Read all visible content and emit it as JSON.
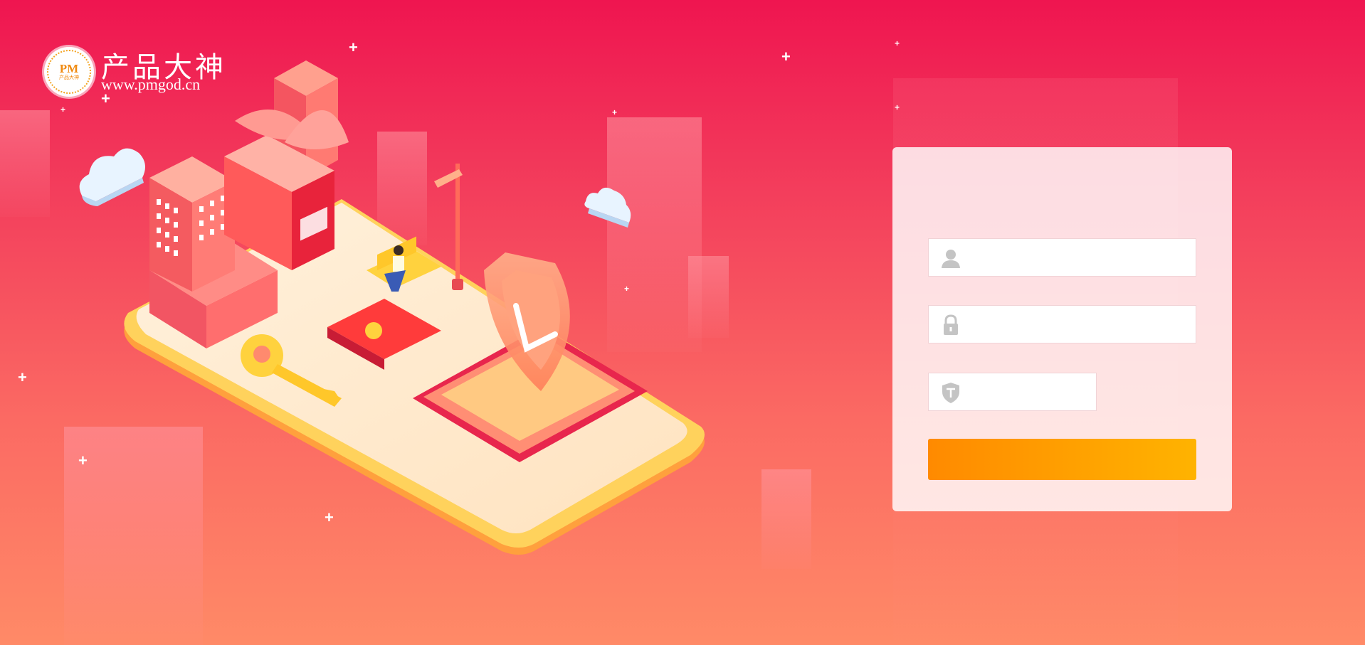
{
  "brand": {
    "name": "产品大神",
    "url": "www.pmgod.cn",
    "seal_text": "PM",
    "seal_subtext": "产品大神"
  },
  "login": {
    "username": {
      "value": "",
      "placeholder": ""
    },
    "password": {
      "value": "",
      "placeholder": ""
    },
    "captcha": {
      "value": "",
      "placeholder": ""
    },
    "submit_label": ""
  },
  "colors": {
    "background_top": "#ef1550",
    "background_bottom": "#ff8a67",
    "button_start": "#ff8a00",
    "button_end": "#ffb300",
    "icon_gray": "#c4c4c4"
  },
  "icons": [
    "user-icon",
    "lock-icon",
    "shield-captcha-icon"
  ]
}
